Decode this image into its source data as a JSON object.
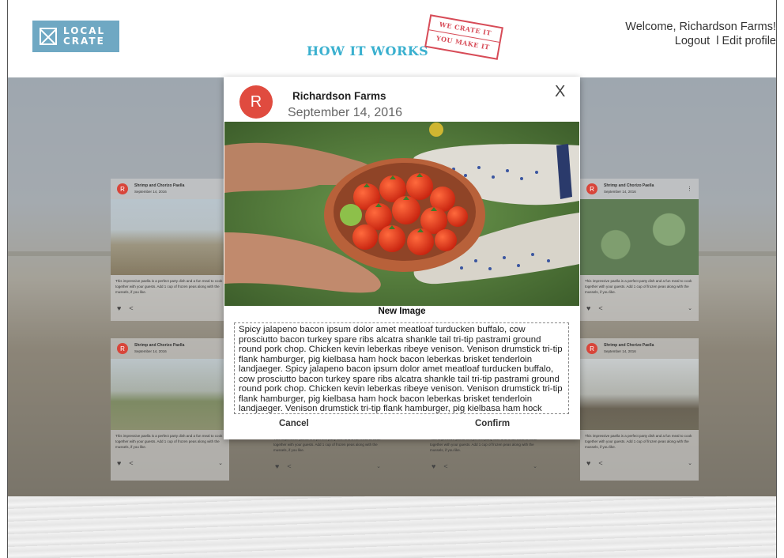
{
  "header": {
    "logo_line1": "LOCAL",
    "logo_line2": "CRATE",
    "how_it_works": "HOW IT WORKS",
    "stamp_line1": "WE CRATE IT",
    "stamp_line2": "YOU MAKE IT",
    "welcome": "Welcome, Richardson Farms!",
    "logout": "Logout",
    "separator": "l",
    "edit_profile": "Edit profile"
  },
  "cards": [
    {
      "avatar": "R",
      "title": "Shrimp and Chorizo Paella",
      "date": "September 14, 2016",
      "text": "This impressive paella is a perfect party dish and a fun meal to cook together with your guests. Add 1 cup of frozen peas along with the mussels, if you like.",
      "icon": "road-field"
    },
    {
      "avatar": "R",
      "title": "Shrimp and Chorizo Paella",
      "date": "September 14, 2016",
      "text": "This impressive paella is a perfect party dish and a fun meal to cook together with your guests. Add 1 cup of frozen peas along with the mussels, if you like.",
      "icon": "lettuce"
    },
    {
      "avatar": "R",
      "title": "Shrimp and Chorizo Paella",
      "date": "September 14, 2016",
      "text": "This impressive paella is a perfect party dish and a fun meal to cook together with your guests. Add 1 cup of frozen peas along with the mussels, if you like.",
      "icon": "family-field"
    },
    {
      "avatar": "R",
      "title": "Shrimp and Chorizo Paella",
      "date": "September 14, 2016",
      "text": "This impressive paella is a perfect party dish and a fun meal to cook together with your guests. Add 1 cup of frozen peas along with the mussels, if you like.",
      "icon": "tractor"
    },
    {
      "text": "This impressive paella is a perfect party dish and a fun meal to cook together with your guests. Add 1 cup of frozen peas along with the mussels, if you like."
    },
    {
      "text": "This impressive paella is a perfect party dish and a fun meal to cook together with your guests. Add 1 cup of frozen peas along with the mussels, if you like."
    }
  ],
  "modal": {
    "avatar": "R",
    "name": "Richardson Farms",
    "date": "September 14, 2016",
    "close": "X",
    "caption": "New Image",
    "body": "Spicy jalapeno bacon ipsum dolor amet meatloaf turducken buffalo, cow prosciutto bacon turkey spare ribs alcatra shankle tail tri-tip pastrami ground round pork chop. Chicken kevin leberkas ribeye venison. Venison drumstick tri-tip flank hamburger, pig kielbasa ham hock bacon leberkas brisket tenderloin landjaeger. Spicy jalapeno bacon ipsum dolor amet meatloaf turducken buffalo, cow prosciutto bacon turkey spare ribs alcatra shankle tail tri-tip pastrami ground round pork chop. Chicken kevin leberkas ribeye venison. Venison drumstick tri-tip flank hamburger, pig kielbasa ham hock bacon leberkas brisket tenderloin landjaeger. Venison drumstick tri-tip flank hamburger, pig kielbasa ham hock bacon leberkas brisket tenderloin landjaeger.",
    "cancel": "Cancel",
    "confirm": "Confirm"
  },
  "colors": {
    "logo_bg": "#6fa8c3",
    "how_it_works": "#3ab0cf",
    "stamp": "#d74b57",
    "avatar": "#e04b3f"
  }
}
